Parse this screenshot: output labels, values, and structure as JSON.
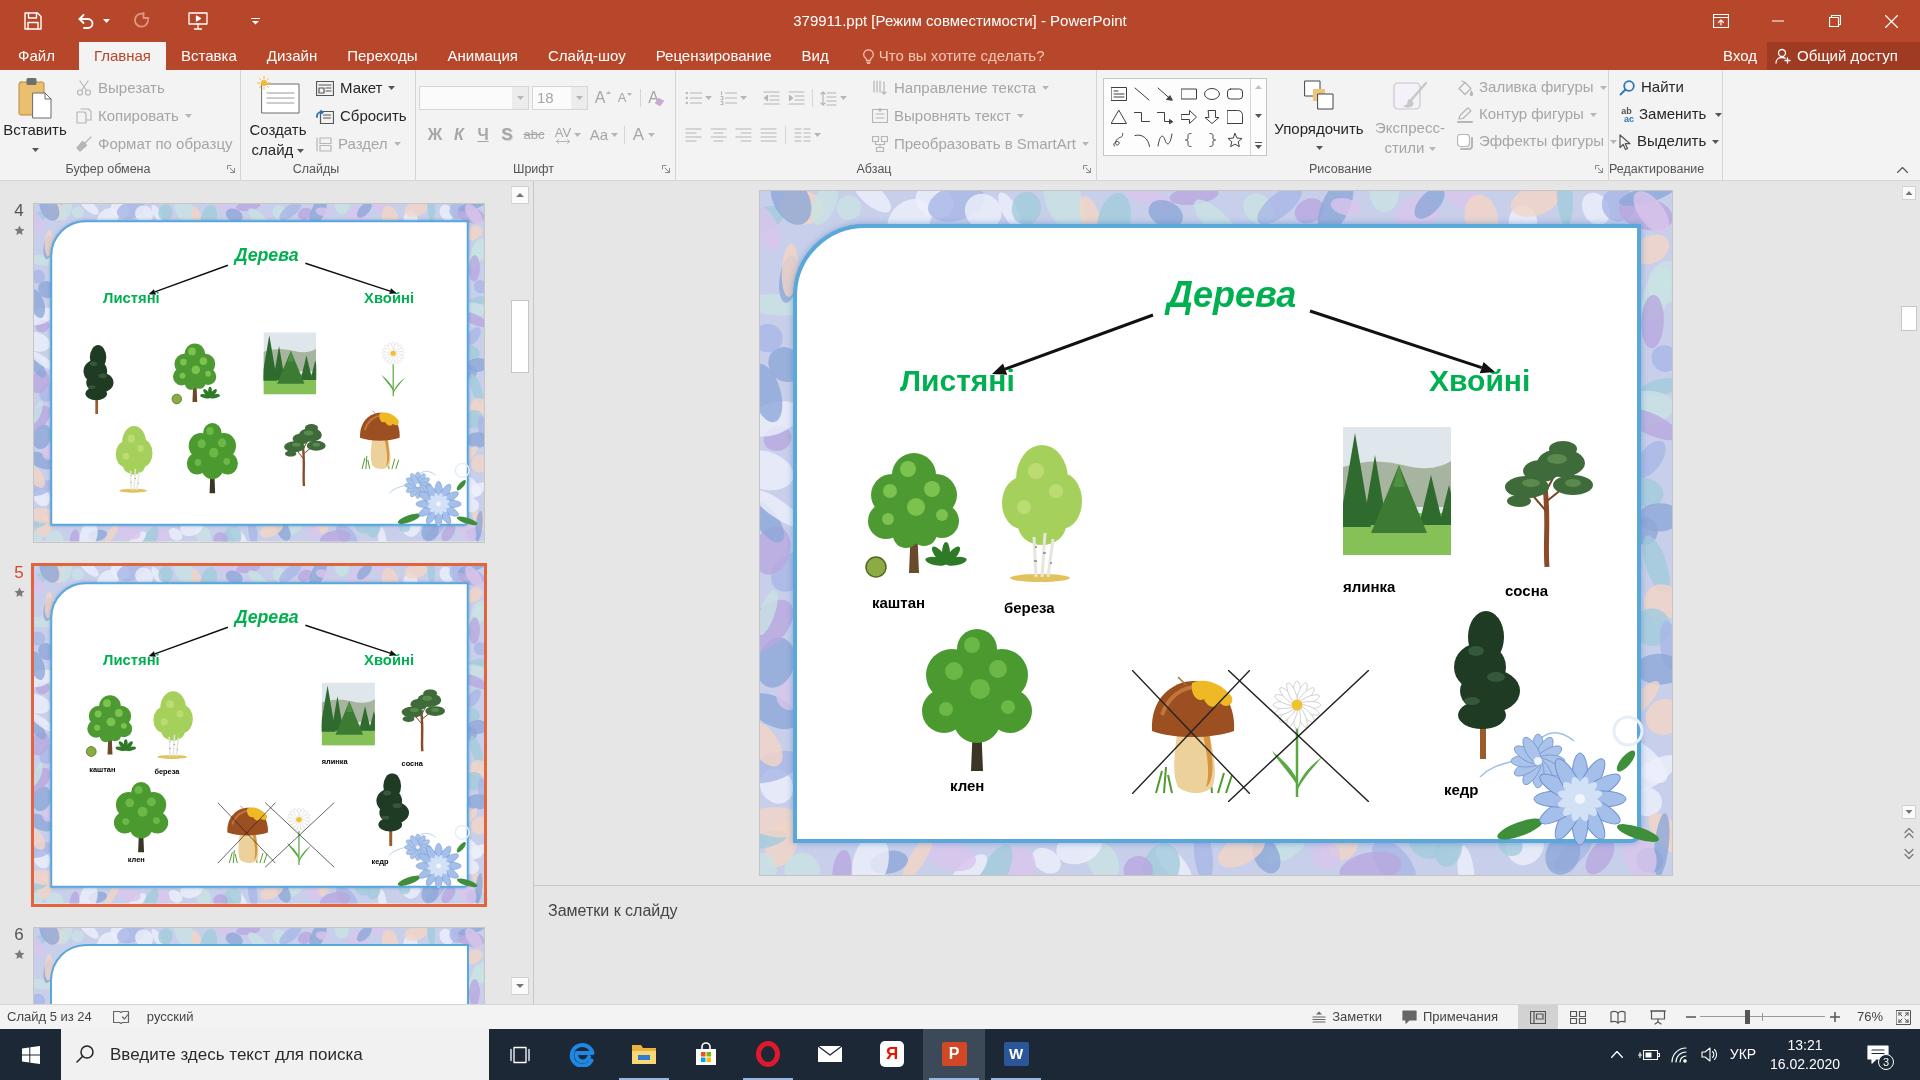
{
  "window": {
    "title": "379911.ppt [Режим совместимости] - PowerPoint"
  },
  "quick_access": [
    {
      "kind": "save",
      "disabled": false
    },
    {
      "kind": "undo",
      "disabled": false
    },
    {
      "kind": "redo",
      "disabled": true
    },
    {
      "kind": "slideshow",
      "disabled": false
    }
  ],
  "tabs": [
    {
      "label": "Файл",
      "selected": false
    },
    {
      "label": "Главная",
      "selected": true
    },
    {
      "label": "Вставка",
      "selected": false
    },
    {
      "label": "Дизайн",
      "selected": false
    },
    {
      "label": "Переходы",
      "selected": false
    },
    {
      "label": "Анимация",
      "selected": false
    },
    {
      "label": "Слайд-шоу",
      "selected": false
    },
    {
      "label": "Рецензирование",
      "selected": false
    },
    {
      "label": "Вид",
      "selected": false
    }
  ],
  "tell_me": {
    "placeholder": "Что вы хотите сделать?"
  },
  "account": {
    "sign_in": "Вход",
    "share": "Общий доступ"
  },
  "ribbon": {
    "clipboard": {
      "label": "Буфер обмена",
      "paste": {
        "label": "Вставить",
        "disabled": false
      },
      "cut": {
        "label": "Вырезать",
        "disabled": true
      },
      "copy": {
        "label": "Копировать",
        "disabled": true
      },
      "format_painter": {
        "label": "Формат по образцу",
        "disabled": true
      }
    },
    "slides": {
      "label": "Слайды",
      "new_slide": {
        "label": "Создать слайд",
        "disabled": false
      },
      "layout": {
        "label": "Макет",
        "disabled": false
      },
      "reset": {
        "label": "Сбросить",
        "disabled": false
      },
      "section": {
        "label": "Раздел",
        "disabled": true
      }
    },
    "font": {
      "label": "Шрифт",
      "disabled": true,
      "size": "18",
      "size_buttons": [
        {
          "kind": "grow",
          "label": "A"
        },
        {
          "kind": "shrink",
          "label": "A"
        },
        {
          "kind": "clear",
          "label": "A"
        }
      ],
      "format_buttons": [
        {
          "kind": "bold",
          "label": "Ж"
        },
        {
          "kind": "italic",
          "label": "К"
        },
        {
          "kind": "underline",
          "label": "Ч"
        },
        {
          "kind": "shadow",
          "label": "S"
        },
        {
          "kind": "strikethrough",
          "label": "abc"
        },
        {
          "kind": "spacing",
          "label": "AV"
        },
        {
          "kind": "case",
          "label": "Aa"
        },
        {
          "kind": "color",
          "label": "A"
        }
      ]
    },
    "paragraph": {
      "label": "Абзац",
      "disabled": true,
      "commands": [
        {
          "kind": "text_direction",
          "label": "Направление текста"
        },
        {
          "kind": "align_text",
          "label": "Выровнять текст"
        },
        {
          "kind": "smartart",
          "label": "Преобразовать в SmartArt"
        }
      ]
    },
    "drawing": {
      "label": "Рисование",
      "arrange": {
        "label": "Упорядочить",
        "disabled": false
      },
      "quick_styles": {
        "label": "Экспресс-стили",
        "disabled": true
      },
      "shape_commands": [
        {
          "kind": "fill",
          "label": "Заливка фигуры",
          "disabled": true
        },
        {
          "kind": "outline",
          "label": "Контур фигуры",
          "disabled": true
        },
        {
          "kind": "effects",
          "label": "Эффекты фигуры",
          "disabled": true
        }
      ]
    },
    "editing": {
      "label": "Редактирование",
      "find": {
        "label": "Найти",
        "disabled": false
      },
      "replace": {
        "label": "Заменить",
        "disabled": false,
        "icon_text": [
          "ab",
          "ac"
        ]
      },
      "select": {
        "label": "Выделить",
        "disabled": false
      }
    }
  },
  "thumbnails": [
    {
      "number": "4",
      "selected": false,
      "slide": {
        "title": "Дерева",
        "headings": [
          "Листяні",
          "Хвойні"
        ],
        "items": [
          {
            "kind": "cedar"
          },
          {
            "kind": "chestnut"
          },
          {
            "kind": "spruce"
          },
          {
            "kind": "daisy",
            "crossed": false
          },
          {
            "kind": "birch"
          },
          {
            "kind": "maple"
          },
          {
            "kind": "pine"
          },
          {
            "kind": "mushroom",
            "crossed": false
          }
        ]
      }
    },
    {
      "number": "5",
      "selected": true,
      "slide": {
        "title": "Дерева",
        "headings": [
          "Листяні",
          "Хвойні"
        ],
        "items": [
          {
            "kind": "chestnut",
            "label": "каштан"
          },
          {
            "kind": "birch",
            "label": "береза"
          },
          {
            "kind": "spruce",
            "label": "ялинка"
          },
          {
            "kind": "pine",
            "label": "сосна"
          },
          {
            "kind": "maple",
            "label": "клен"
          },
          {
            "kind": "mushroom",
            "crossed": true
          },
          {
            "kind": "daisy",
            "crossed": true
          },
          {
            "kind": "cedar",
            "label": "кедр"
          }
        ]
      }
    },
    {
      "number": "6",
      "selected": false
    }
  ],
  "slide": {
    "title": "Дерева",
    "headings": [
      "Листяні",
      "Хвойні"
    ],
    "items": [
      {
        "kind": "chestnut",
        "label": "каштан"
      },
      {
        "kind": "birch",
        "label": "береза"
      },
      {
        "kind": "spruce",
        "label": "ялинка"
      },
      {
        "kind": "pine",
        "label": "сосна"
      },
      {
        "kind": "maple",
        "label": "клен"
      },
      {
        "kind": "mushroom",
        "crossed": true
      },
      {
        "kind": "daisy",
        "crossed": true
      },
      {
        "kind": "cedar",
        "label": "кедр"
      }
    ]
  },
  "notes": {
    "placeholder": "Заметки к слайду"
  },
  "status_bar": {
    "slide_info": "Слайд 5 из 24",
    "language": "русский",
    "notes": "Заметки",
    "comments": "Примечания",
    "views": [
      {
        "kind": "normal",
        "selected": true
      },
      {
        "kind": "sorter",
        "selected": false
      },
      {
        "kind": "reading",
        "selected": false
      },
      {
        "kind": "slideshow",
        "selected": false
      }
    ],
    "zoom": {
      "level": 0.38,
      "reading": "76%"
    }
  },
  "taskbar": {
    "search": {
      "placeholder": "Введите здесь текст для поиска"
    },
    "apps": [
      {
        "kind": "edge",
        "running": false,
        "selected": false
      },
      {
        "kind": "explorer",
        "running": true,
        "selected": false
      },
      {
        "kind": "store",
        "running": false,
        "selected": false
      },
      {
        "kind": "opera",
        "running": true,
        "selected": false
      },
      {
        "kind": "mail",
        "running": false,
        "selected": false
      },
      {
        "kind": "yandex",
        "running": false,
        "selected": false,
        "logo_text": "Я"
      },
      {
        "kind": "powerpoint",
        "running": true,
        "selected": true,
        "logo_text": "P"
      },
      {
        "kind": "word",
        "running": true,
        "selected": false,
        "logo_text": "W"
      }
    ],
    "tray": {
      "language": "УКР",
      "time": "13:21",
      "date": "16.02.2020",
      "notifications": "3"
    }
  }
}
